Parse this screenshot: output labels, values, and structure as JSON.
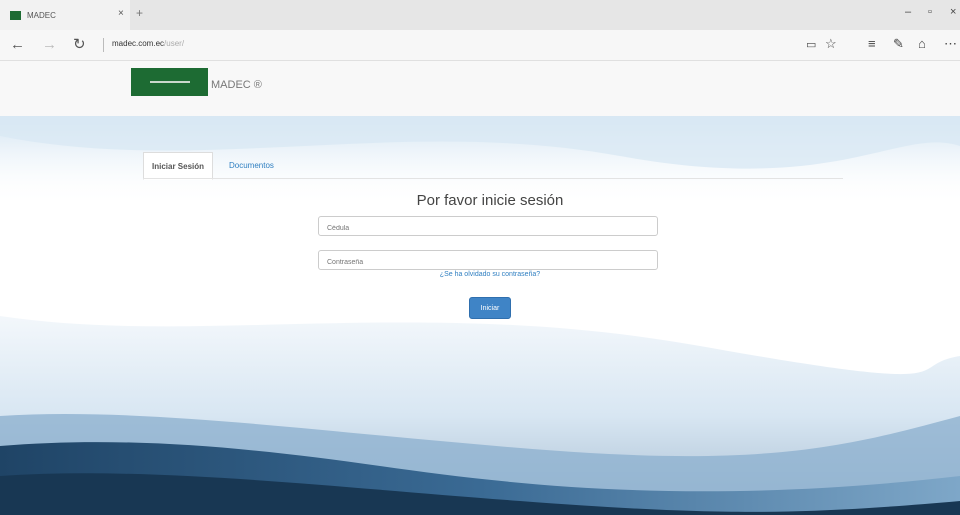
{
  "browser": {
    "tab_title": "MADEC",
    "tab_close": "×",
    "new_tab": "+",
    "address_host": "madec.com.ec",
    "address_path": "/user/",
    "window_controls": [
      "–",
      "▫",
      "×"
    ],
    "toolbar_icons": [
      "reading-view-icon",
      "favorites-star-icon",
      "hub-icon",
      "web-note-icon",
      "share-icon",
      "more-icon"
    ]
  },
  "site": {
    "brand": "MADEC ®",
    "logo_color": "#1d6b33"
  },
  "tabs": {
    "active": "Iniciar Sesión",
    "other": "Documentos"
  },
  "login": {
    "heading": "Por favor inicie sesión",
    "username_placeholder": "Cédula",
    "password_placeholder": "Contraseña",
    "forgot_link": "¿Se ha olvidado su contraseña?",
    "submit_label": "Iniciar"
  },
  "colors": {
    "accent": "#3f84c6",
    "link": "#2f7fc1",
    "brand_green": "#1d6b33"
  }
}
